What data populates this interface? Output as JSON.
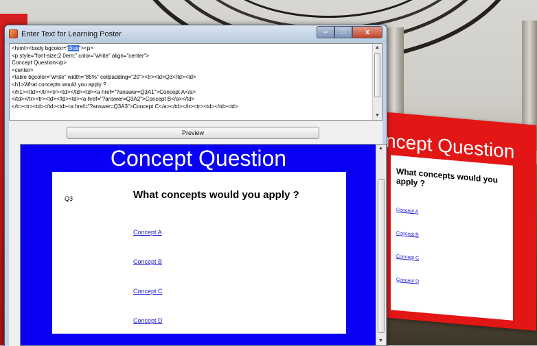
{
  "window": {
    "title": "Enter Text for Learning Poster",
    "minimize_label": "–",
    "maximize_label": "□",
    "close_label": "x"
  },
  "editor": {
    "line_1_pre": "<html><body bgcolor=\"",
    "line_1_selected": "blue",
    "line_1_post": "\"><p>",
    "line_2": "<p style=\"font-size:2.0em;\" color=\"white\" align=\"center\">",
    "line_3": "Concept Question</p>",
    "line_4": "<center>",
    "line_5": "<table bgcolor=\"white\" width=\"85%\" cellpadding=\"20\"><tr><td>Q3</td><td>",
    "line_6": "<h1>What concepts would you apply ?",
    "line_7": "</h1></td></tr><tr><td></td><td><a href=\"?answer=Q3A1\">Concept A</a>",
    "line_8": "</td></tr><tr><td></td><td><a href=\"?answer=Q3A2\">Concept B</a></td>",
    "line_9": "</tr><tr><td></td><td><a href=\"?answer=Q3A3\">Concept C</a></td></tr><tr><td></td><td>"
  },
  "preview_button": "Preview",
  "preview": {
    "title": "Concept Question",
    "question_number": "Q3",
    "question": "What concepts would you apply ?",
    "links": [
      "Concept A",
      "Concept B",
      "Concept C",
      "Concept D"
    ]
  },
  "poster": {
    "title": "ncept Question",
    "question": "What concepts would you apply ?",
    "links": [
      "Concept A",
      "Concept B",
      "Concept C",
      "Concept D"
    ]
  },
  "colors": {
    "preview_background": "#0a00f5",
    "poster_background": "#e31616",
    "link": "#1a1ad0"
  }
}
